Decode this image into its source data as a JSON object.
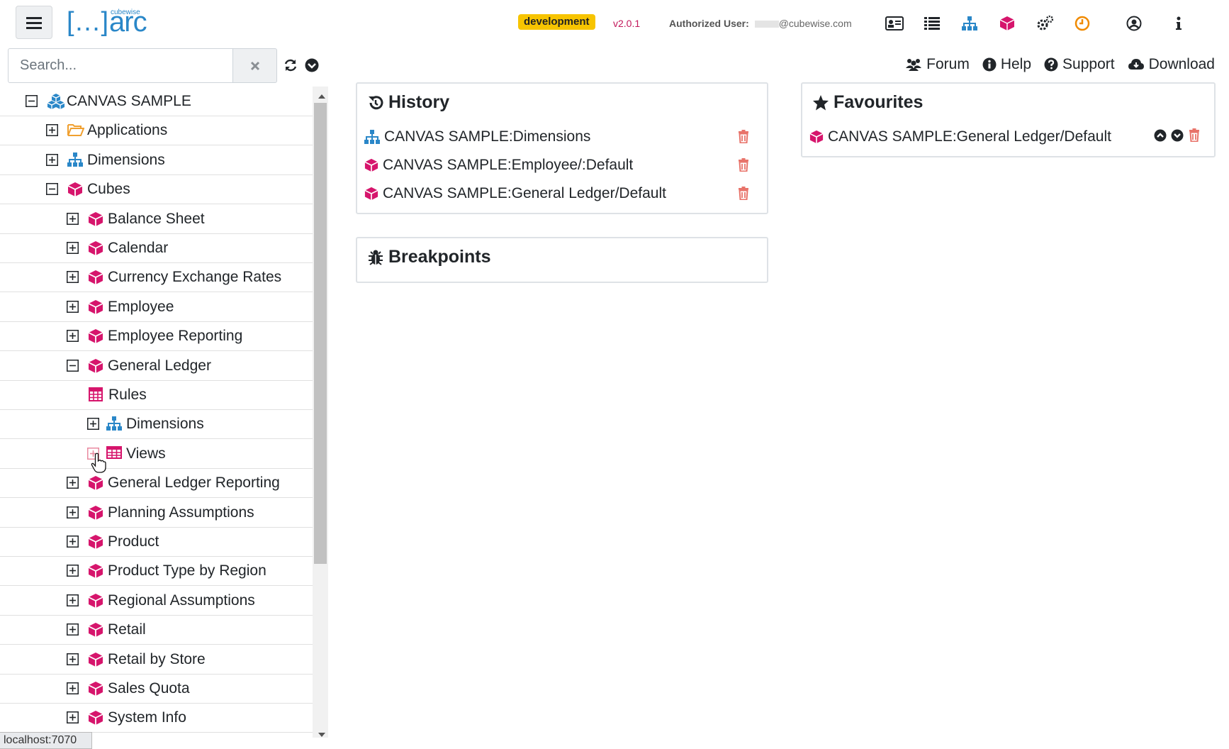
{
  "header": {
    "env_badge": "development",
    "version": "v2.0.1",
    "auth_label": "Authorized User:",
    "auth_user": "@cubewise.com",
    "logo_small": "cubewise",
    "logo_text": "arc",
    "logo_bracket_left": "[…]",
    "icons": [
      "id-card-icon",
      "list-icon",
      "sitemap-icon",
      "cube-icon",
      "gears-icon",
      "clock-icon",
      "user-circle-icon",
      "info-icon"
    ]
  },
  "search": {
    "placeholder": "Search..."
  },
  "links": {
    "forum": "Forum",
    "help": "Help",
    "support": "Support",
    "download": "Download"
  },
  "tree": [
    {
      "label": "CANVAS SAMPLE",
      "toggle": "minus",
      "icon": "server-cubes-icon",
      "level": 0
    },
    {
      "label": "Applications",
      "toggle": "plus",
      "icon": "folder-open-icon",
      "level": 1
    },
    {
      "label": "Dimensions",
      "toggle": "plus",
      "icon": "sitemap-icon",
      "level": 1
    },
    {
      "label": "Cubes",
      "toggle": "minus",
      "icon": "cube-icon",
      "level": 1
    },
    {
      "label": "Balance Sheet",
      "toggle": "plus",
      "icon": "cube-icon",
      "level": 2
    },
    {
      "label": "Calendar",
      "toggle": "plus",
      "icon": "cube-icon",
      "level": 2
    },
    {
      "label": "Currency Exchange Rates",
      "toggle": "plus",
      "icon": "cube-icon",
      "level": 2
    },
    {
      "label": "Employee",
      "toggle": "plus",
      "icon": "cube-icon",
      "level": 2
    },
    {
      "label": "Employee Reporting",
      "toggle": "plus",
      "icon": "cube-icon",
      "level": 2
    },
    {
      "label": "General Ledger",
      "toggle": "minus",
      "icon": "cube-icon",
      "level": 2
    },
    {
      "label": "Rules",
      "toggle": "none",
      "icon": "calculator-icon",
      "level": 3
    },
    {
      "label": "Dimensions",
      "toggle": "plus",
      "icon": "sitemap-icon",
      "level": 3
    },
    {
      "label": "Views",
      "toggle": "plus-hover",
      "icon": "table-icon",
      "level": 3
    },
    {
      "label": "General Ledger Reporting",
      "toggle": "plus",
      "icon": "cube-icon",
      "level": 2
    },
    {
      "label": "Planning Assumptions",
      "toggle": "plus",
      "icon": "cube-icon",
      "level": 2
    },
    {
      "label": "Product",
      "toggle": "plus",
      "icon": "cube-icon",
      "level": 2
    },
    {
      "label": "Product Type by Region",
      "toggle": "plus",
      "icon": "cube-icon",
      "level": 2
    },
    {
      "label": "Regional Assumptions",
      "toggle": "plus",
      "icon": "cube-icon",
      "level": 2
    },
    {
      "label": "Retail",
      "toggle": "plus",
      "icon": "cube-icon",
      "level": 2
    },
    {
      "label": "Retail by Store",
      "toggle": "plus",
      "icon": "cube-icon",
      "level": 2
    },
    {
      "label": "Sales Quota",
      "toggle": "plus",
      "icon": "cube-icon",
      "level": 2
    },
    {
      "label": "System Info",
      "toggle": "plus",
      "icon": "cube-icon",
      "level": 2
    }
  ],
  "history": {
    "title": "History",
    "items": [
      {
        "label": "CANVAS SAMPLE:Dimensions",
        "icon": "sitemap-icon"
      },
      {
        "label": "CANVAS SAMPLE:Employee/:Default",
        "icon": "cube-icon"
      },
      {
        "label": "CANVAS SAMPLE:General Ledger/Default",
        "icon": "cube-icon"
      }
    ]
  },
  "breakpoints": {
    "title": "Breakpoints"
  },
  "favourites": {
    "title": "Favourites",
    "items": [
      {
        "label": "CANVAS SAMPLE:General Ledger/Default",
        "icon": "cube-icon"
      }
    ]
  },
  "status_bar": "localhost:7070",
  "colors": {
    "accent_blue": "#2a87c8",
    "cube_magenta": "#d6156c",
    "trash_red": "#e8736a",
    "badge_yellow": "#f7c400",
    "folder_orange": "#f0a030"
  }
}
